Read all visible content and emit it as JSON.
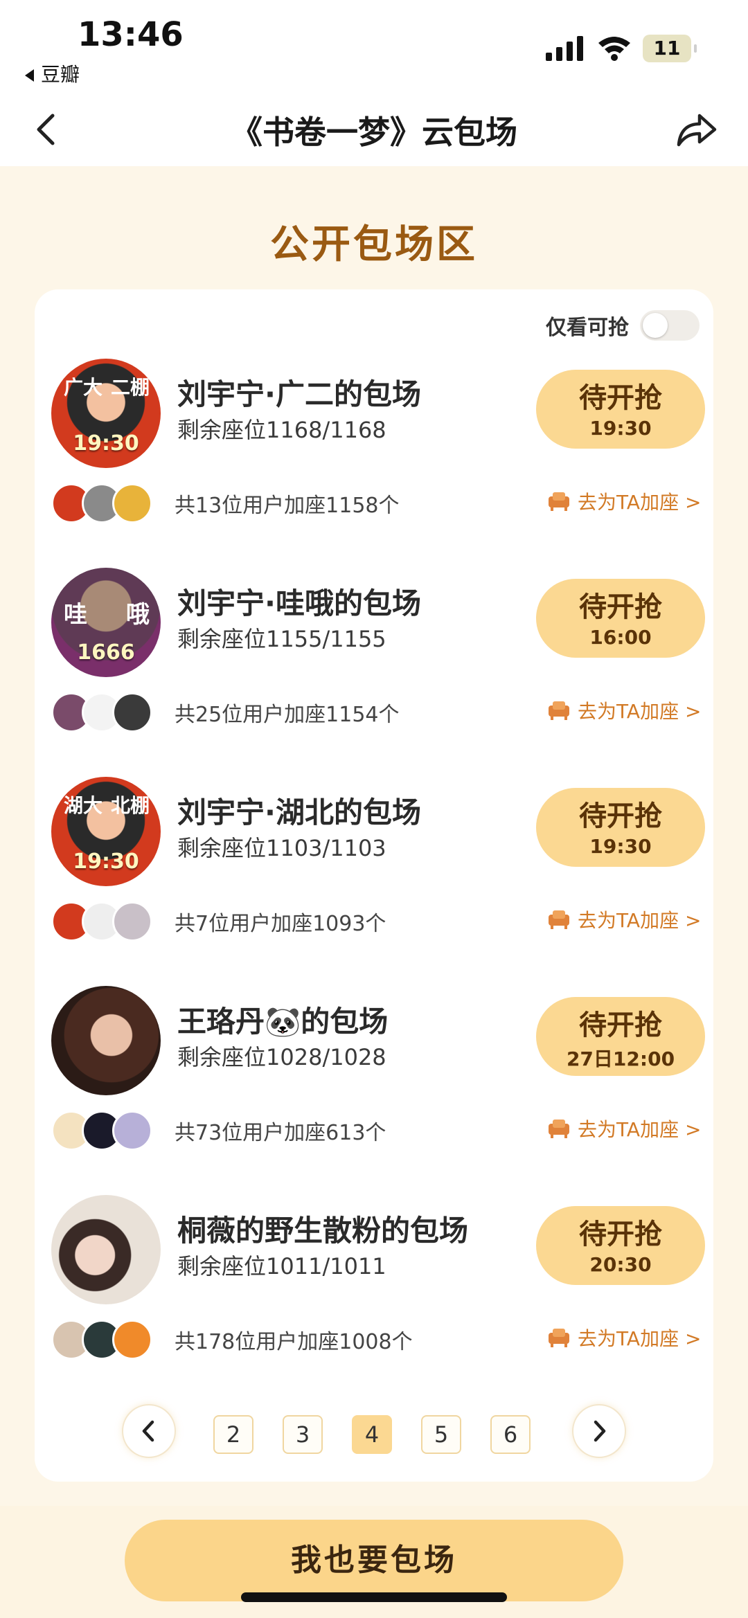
{
  "status_bar": {
    "time": "13:46",
    "back_app": "豆瓣",
    "battery": "11"
  },
  "nav": {
    "title": "《书卷一梦》云包场"
  },
  "section": {
    "title": "公开包场区"
  },
  "filter": {
    "label": "仅看可抢",
    "enabled": false
  },
  "items": [
    {
      "name": "刘宇宁·广二的包场",
      "seats": "剩余座位1168/1168",
      "status": "待开抢",
      "time": "19:30",
      "members": "共13位用户加座1158个",
      "action": "去为TA加座 >",
      "avatar_caption": "19:30",
      "corner_l": "广大",
      "corner_r": "二棚"
    },
    {
      "name": "刘宇宁·哇哦的包场",
      "seats": "剩余座位1155/1155",
      "status": "待开抢",
      "time": "16:00",
      "members": "共25位用户加座1154个",
      "action": "去为TA加座 >",
      "avatar_caption": "1666",
      "corner_l": "哇",
      "corner_r": "哦"
    },
    {
      "name": "刘宇宁·湖北的包场",
      "seats": "剩余座位1103/1103",
      "status": "待开抢",
      "time": "19:30",
      "members": "共7位用户加座1093个",
      "action": "去为TA加座 >",
      "avatar_caption": "19:30",
      "corner_l": "湖大",
      "corner_r": "北棚"
    },
    {
      "name": "王珞丹🐼的包场",
      "seats": "剩余座位1028/1028",
      "status": "待开抢",
      "time": "27日12:00",
      "members": "共73位用户加座613个",
      "action": "去为TA加座 >",
      "avatar_caption": "",
      "corner_l": "",
      "corner_r": ""
    },
    {
      "name": "桐薇的野生散粉的包场",
      "seats": "剩余座位1011/1011",
      "status": "待开抢",
      "time": "20:30",
      "members": "共178位用户加座1008个",
      "action": "去为TA加座 >",
      "avatar_caption": "",
      "corner_l": "",
      "corner_r": ""
    }
  ],
  "pager": {
    "pages": [
      "2",
      "3",
      "4",
      "5",
      "6"
    ],
    "current": "4"
  },
  "bottom": {
    "cta": "我也要包场"
  },
  "colors": {
    "accent": "#fbd892",
    "title_brown": "#9a5a12",
    "link_orange": "#d27a26",
    "background": "#fdf6e8"
  }
}
